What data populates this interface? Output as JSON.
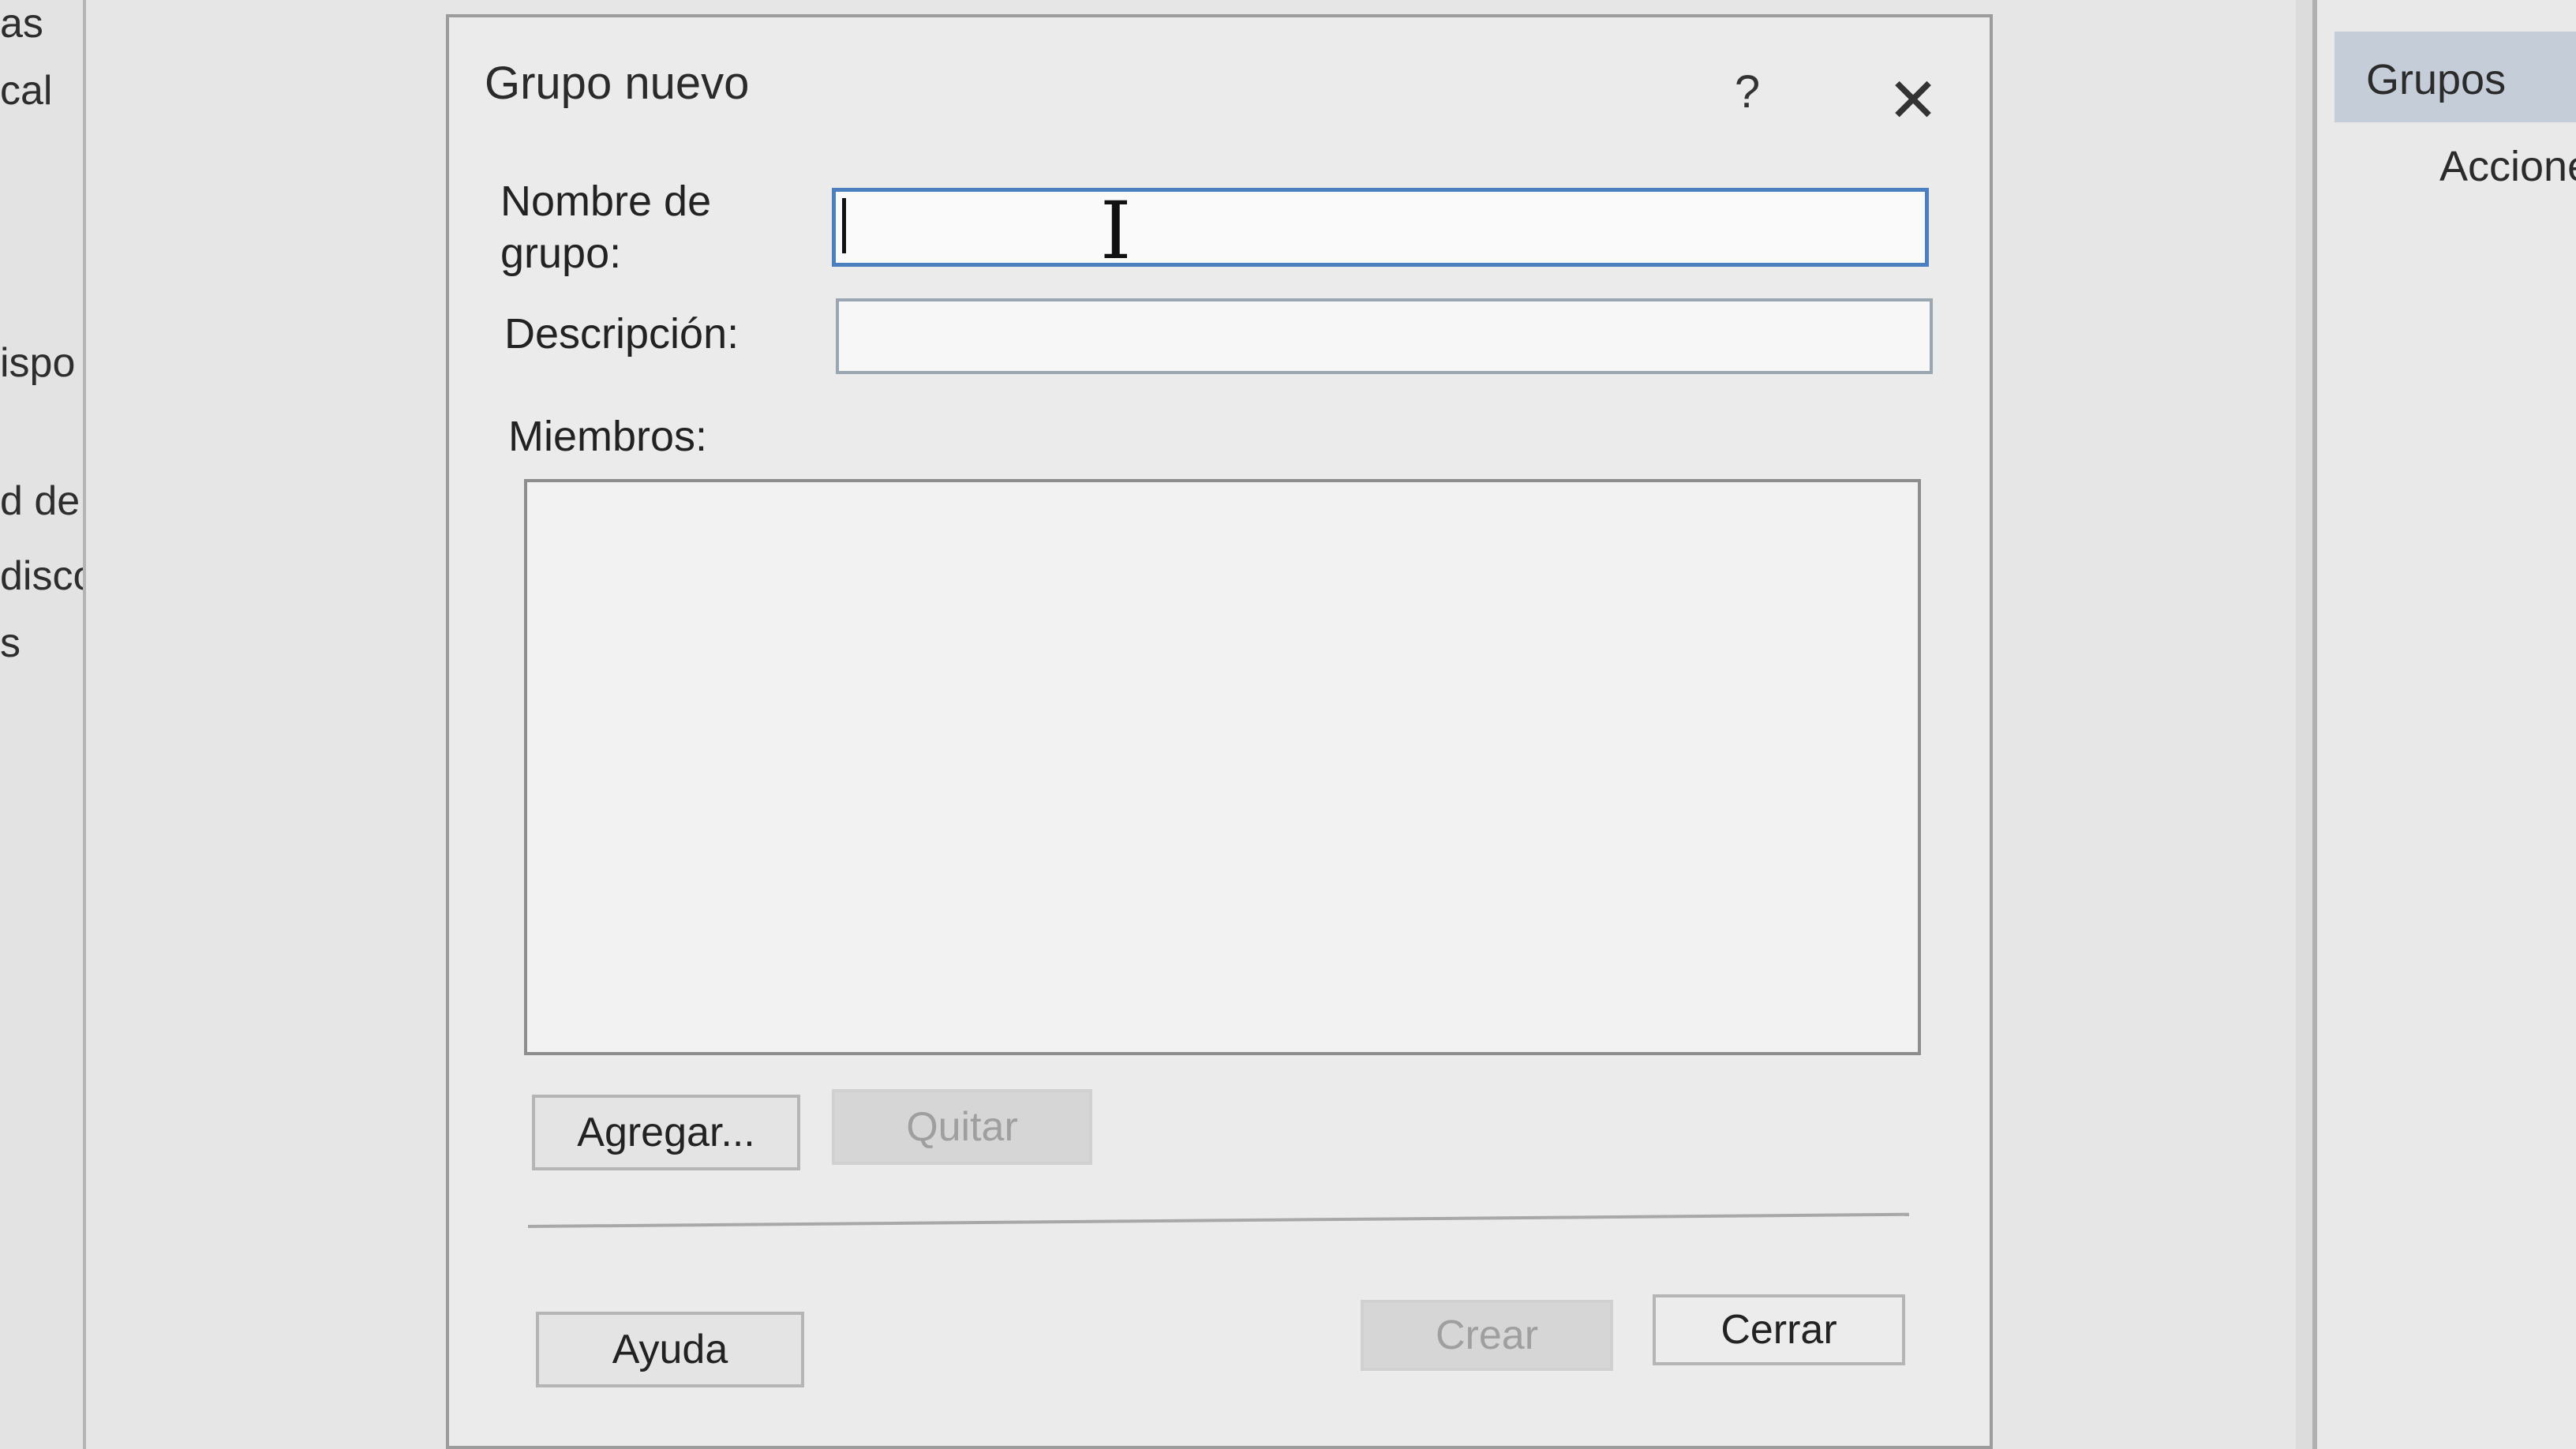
{
  "background": {
    "left_pane_items": [
      "as",
      "cal",
      "ispo",
      "d de",
      "disco",
      "s"
    ],
    "right_pane": {
      "header": "Grupos",
      "subheader": "Accione"
    }
  },
  "dialog": {
    "title": "Grupo nuevo",
    "help_glyph": "?",
    "close_glyph": "✕",
    "group_name": {
      "label": "Nombre de grupo:",
      "value": ""
    },
    "description": {
      "label": "Descripción:",
      "value": ""
    },
    "members": {
      "label": "Miembros:",
      "items": []
    },
    "buttons": {
      "add": "Agregar...",
      "remove": "Quitar",
      "help": "Ayuda",
      "create": "Crear",
      "close": "Cerrar"
    }
  }
}
